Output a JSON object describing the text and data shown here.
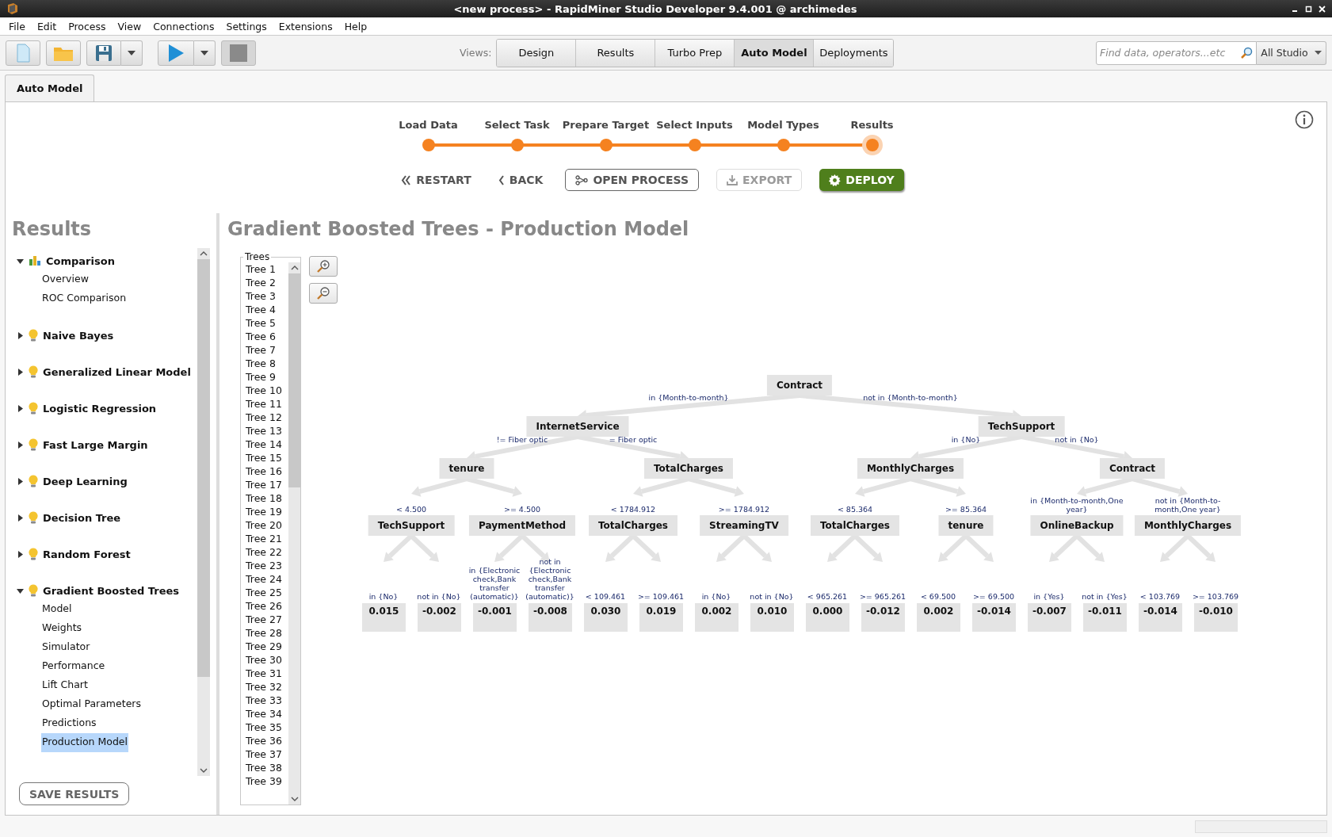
{
  "window": {
    "title": "<new process> - RapidMiner Studio Developer 9.4.001 @ archimedes"
  },
  "menu": [
    "File",
    "Edit",
    "Process",
    "View",
    "Connections",
    "Settings",
    "Extensions",
    "Help"
  ],
  "views": {
    "label": "Views:",
    "items": [
      {
        "label": "Design",
        "selected": false
      },
      {
        "label": "Results",
        "selected": false
      },
      {
        "label": "Turbo Prep",
        "selected": false
      },
      {
        "label": "Auto Model",
        "selected": true
      },
      {
        "label": "Deployments",
        "selected": false
      }
    ]
  },
  "search": {
    "placeholder": "Find data, operators...etc",
    "scope": "All Studio"
  },
  "tabs": [
    {
      "label": "Auto Model",
      "selected": true
    }
  ],
  "steps": [
    {
      "label": "Load Data",
      "selected": false
    },
    {
      "label": "Select Task",
      "selected": false
    },
    {
      "label": "Prepare Target",
      "selected": false
    },
    {
      "label": "Select Inputs",
      "selected": false
    },
    {
      "label": "Model Types",
      "selected": false
    },
    {
      "label": "Results",
      "selected": true
    }
  ],
  "actions": [
    {
      "label": "RESTART",
      "kind": "restart",
      "disabled": false
    },
    {
      "label": "BACK",
      "kind": "back",
      "disabled": false
    },
    {
      "label": "OPEN PROCESS",
      "kind": "open",
      "disabled": false
    },
    {
      "label": "EXPORT",
      "kind": "export",
      "disabled": true
    },
    {
      "label": "DEPLOY",
      "kind": "deploy",
      "disabled": false
    }
  ],
  "sidebar": {
    "title": "Results",
    "save_button": "SAVE RESULTS",
    "items": [
      {
        "label": "Comparison",
        "kind": "comparison",
        "expanded": true,
        "children": [
          {
            "label": "Overview",
            "selected": false
          },
          {
            "label": "ROC Comparison",
            "selected": false
          }
        ]
      },
      {
        "label": "Naive Bayes",
        "kind": "model",
        "expanded": false
      },
      {
        "label": "Generalized Linear Model",
        "kind": "model",
        "expanded": false
      },
      {
        "label": "Logistic Regression",
        "kind": "model",
        "expanded": false
      },
      {
        "label": "Fast Large Margin",
        "kind": "model",
        "expanded": false
      },
      {
        "label": "Deep Learning",
        "kind": "model",
        "expanded": false
      },
      {
        "label": "Decision Tree",
        "kind": "model",
        "expanded": false
      },
      {
        "label": "Random Forest",
        "kind": "model",
        "expanded": false
      },
      {
        "label": "Gradient Boosted Trees",
        "kind": "model",
        "expanded": true,
        "children": [
          {
            "label": "Model",
            "selected": false
          },
          {
            "label": "Weights",
            "selected": false
          },
          {
            "label": "Simulator",
            "selected": false
          },
          {
            "label": "Performance",
            "selected": false
          },
          {
            "label": "Lift Chart",
            "selected": false
          },
          {
            "label": "Optimal Parameters",
            "selected": false
          },
          {
            "label": "Predictions",
            "selected": false
          },
          {
            "label": "Production Model",
            "selected": true
          }
        ]
      }
    ]
  },
  "content": {
    "title": "Gradient Boosted Trees - Production Model",
    "trees_list": {
      "legend": "Trees",
      "items": [
        {
          "label": "Tree 1",
          "selected": false
        },
        {
          "label": "Tree 2",
          "selected": false
        },
        {
          "label": "Tree 3",
          "selected": false
        },
        {
          "label": "Tree 4",
          "selected": false
        },
        {
          "label": "Tree 5",
          "selected": false
        },
        {
          "label": "Tree 6",
          "selected": false
        },
        {
          "label": "Tree 7",
          "selected": false
        },
        {
          "label": "Tree 8",
          "selected": false
        },
        {
          "label": "Tree 9",
          "selected": false
        },
        {
          "label": "Tree 10",
          "selected": false
        },
        {
          "label": "Tree 11",
          "selected": false
        },
        {
          "label": "Tree 12",
          "selected": false
        },
        {
          "label": "Tree 13",
          "selected": false
        },
        {
          "label": "Tree 14",
          "selected": false
        },
        {
          "label": "Tree 15",
          "selected": false
        },
        {
          "label": "Tree 16",
          "selected": false
        },
        {
          "label": "Tree 17",
          "selected": false
        },
        {
          "label": "Tree 18",
          "selected": false
        },
        {
          "label": "Tree 19",
          "selected": false
        },
        {
          "label": "Tree 20",
          "selected": false
        },
        {
          "label": "Tree 21",
          "selected": false
        },
        {
          "label": "Tree 22",
          "selected": false
        },
        {
          "label": "Tree 23",
          "selected": false
        },
        {
          "label": "Tree 24",
          "selected": false
        },
        {
          "label": "Tree 25",
          "selected": false
        },
        {
          "label": "Tree 26",
          "selected": false
        },
        {
          "label": "Tree 27",
          "selected": false
        },
        {
          "label": "Tree 28",
          "selected": false
        },
        {
          "label": "Tree 29",
          "selected": false
        },
        {
          "label": "Tree 30",
          "selected": false
        },
        {
          "label": "Tree 31",
          "selected": false
        },
        {
          "label": "Tree 32",
          "selected": false
        },
        {
          "label": "Tree 33",
          "selected": false
        },
        {
          "label": "Tree 34",
          "selected": false
        },
        {
          "label": "Tree 35",
          "selected": false
        },
        {
          "label": "Tree 36",
          "selected": false
        },
        {
          "label": "Tree 37",
          "selected": false
        },
        {
          "label": "Tree 38",
          "selected": false
        },
        {
          "label": "Tree 39",
          "selected": false
        }
      ]
    },
    "tree": {
      "label": "Contract",
      "children": [
        {
          "edge": "in {Month-to-month}",
          "label": "InternetService",
          "children": [
            {
              "edge": "!= Fiber optic",
              "label": "tenure",
              "children": [
                {
                  "edge": "< 4.500",
                  "label": "TechSupport",
                  "children": [
                    {
                      "edge": "in {No}",
                      "value": "0.015"
                    },
                    {
                      "edge": "not in {No}",
                      "value": "-0.002"
                    }
                  ]
                },
                {
                  "edge": ">= 4.500",
                  "label": "PaymentMethod",
                  "children": [
                    {
                      "edge": "in {Electronic check,Bank transfer (automatic)}",
                      "value": "-0.001"
                    },
                    {
                      "edge": "not in {Electronic check,Bank transfer (automatic)}",
                      "value": "-0.008"
                    }
                  ]
                }
              ]
            },
            {
              "edge": "= Fiber optic",
              "label": "TotalCharges",
              "children": [
                {
                  "edge": "< 1784.912",
                  "label": "TotalCharges",
                  "children": [
                    {
                      "edge": "< 109.461",
                      "value": "0.030"
                    },
                    {
                      "edge": ">= 109.461",
                      "value": "0.019"
                    }
                  ]
                },
                {
                  "edge": ">= 1784.912",
                  "label": "StreamingTV",
                  "children": [
                    {
                      "edge": "in {No}",
                      "value": "0.002"
                    },
                    {
                      "edge": "not in {No}",
                      "value": "0.010"
                    }
                  ]
                }
              ]
            }
          ]
        },
        {
          "edge": "not in {Month-to-month}",
          "label": "TechSupport",
          "children": [
            {
              "edge": "in {No}",
              "label": "MonthlyCharges",
              "children": [
                {
                  "edge": "< 85.364",
                  "label": "TotalCharges",
                  "children": [
                    {
                      "edge": "< 965.261",
                      "value": "0.000"
                    },
                    {
                      "edge": ">= 965.261",
                      "value": "-0.012"
                    }
                  ]
                },
                {
                  "edge": ">= 85.364",
                  "label": "tenure",
                  "children": [
                    {
                      "edge": "< 69.500",
                      "value": "0.002"
                    },
                    {
                      "edge": ">= 69.500",
                      "value": "-0.014"
                    }
                  ]
                }
              ]
            },
            {
              "edge": "not in {No}",
              "label": "Contract",
              "children": [
                {
                  "edge": "in {Month-to-month,One year}",
                  "label": "OnlineBackup",
                  "children": [
                    {
                      "edge": "in {Yes}",
                      "value": "-0.007"
                    },
                    {
                      "edge": "not in {Yes}",
                      "value": "-0.011"
                    }
                  ]
                },
                {
                  "edge": "not in {Month-to-month,One year}",
                  "label": "MonthlyCharges",
                  "children": [
                    {
                      "edge": "< 103.769",
                      "value": "-0.014"
                    },
                    {
                      "edge": ">= 103.769",
                      "value": "-0.010"
                    }
                  ]
                }
              ]
            }
          ]
        }
      ]
    }
  }
}
